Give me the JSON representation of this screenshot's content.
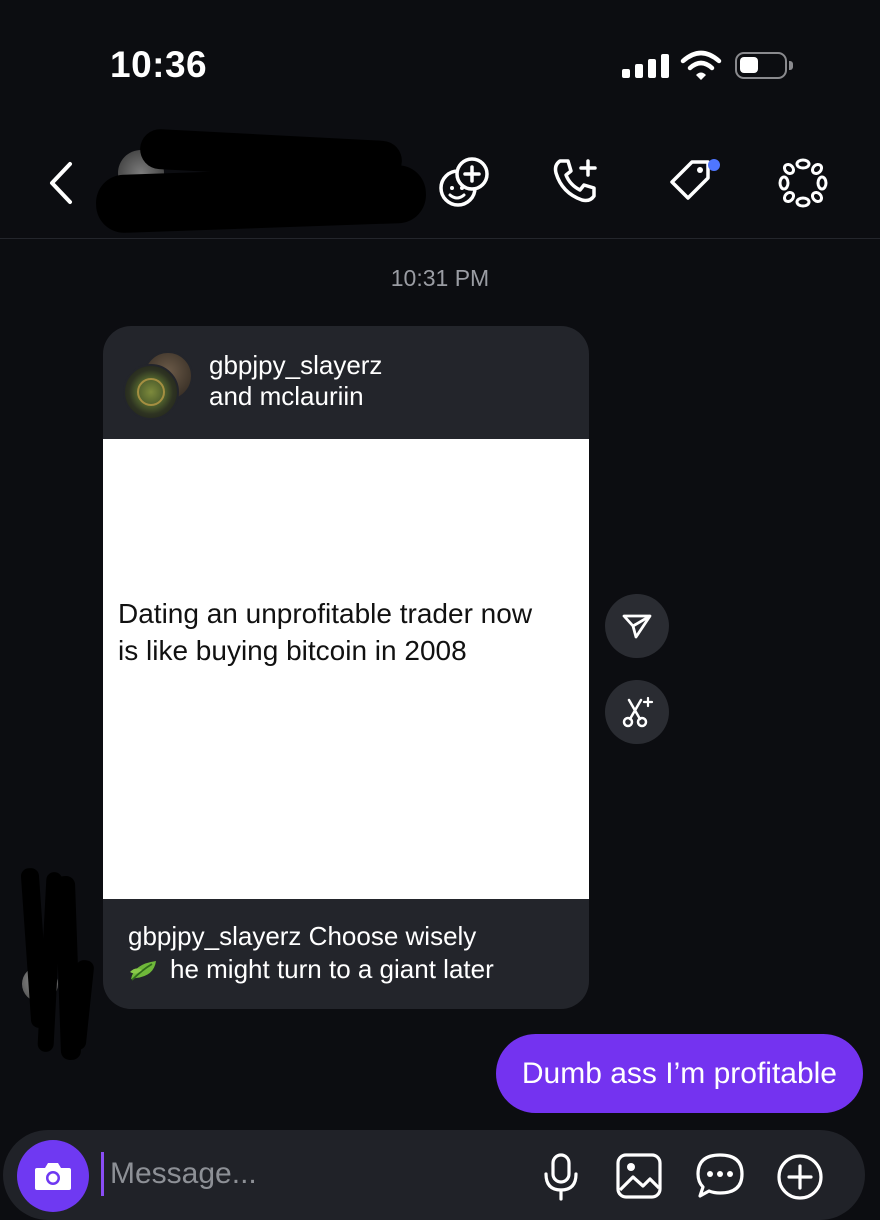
{
  "status_bar": {
    "time": "10:36"
  },
  "header": {
    "back_icon": "chevron-left-icon",
    "actions": [
      "add-effect-icon",
      "add-call-icon",
      "tag-icon",
      "more-icon"
    ],
    "accent_dot_color": "#4f76ff"
  },
  "chat": {
    "timestamp": "10:31 PM",
    "shared_post": {
      "authors_line1": "gbpjpy_slayerz",
      "authors_line2": "and mclauriin",
      "text": "Dating an unprofitable trader now is like buying bitcoin in 2008",
      "caption_user": "gbpjpy_slayerz",
      "caption_text": "Choose wisely",
      "caption_line2": "he might turn to a giant later",
      "caption_emoji": "leaf-icon"
    },
    "side_actions": [
      "share-icon",
      "remix-icon"
    ],
    "my_message": "Dumb ass I’m profitable",
    "my_bubble_color": "#7433f0"
  },
  "composer": {
    "placeholder": "Message...",
    "icons": [
      "camera-icon",
      "microphone-icon",
      "gallery-icon",
      "sticker-icon",
      "plus-icon"
    ]
  }
}
